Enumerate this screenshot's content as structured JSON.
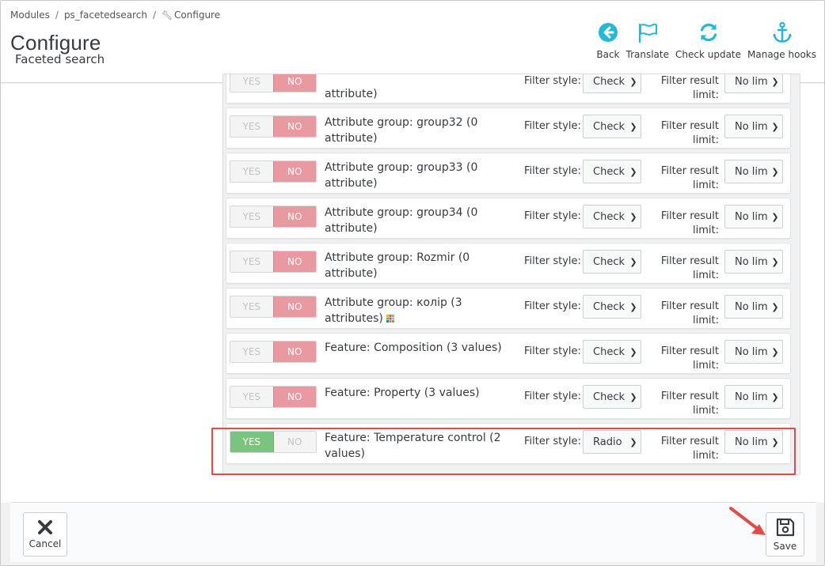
{
  "breadcrumb": {
    "items": [
      "Modules",
      "ps_facetedsearch",
      "Configure"
    ],
    "separator": "/"
  },
  "page": {
    "title": "Configure",
    "subtitle": "Faceted search"
  },
  "toolbar": {
    "back": "Back",
    "translate": "Translate",
    "check_update": "Check update",
    "manage_hooks": "Manage hooks"
  },
  "filter_rows": [
    {
      "label": "attribute)",
      "yes": "YES",
      "no": "NO",
      "enabled": false,
      "style_label": "Filter style:",
      "style_value": "Check",
      "limit_label": "Filter result limit:",
      "limit_value": "No limit"
    },
    {
      "label": "Attribute group: group32 (0 attribute)",
      "yes": "YES",
      "no": "NO",
      "enabled": false,
      "style_label": "Filter style:",
      "style_value": "Check",
      "limit_label": "Filter result limit:",
      "limit_value": "No limit"
    },
    {
      "label": "Attribute group: group33 (0 attribute)",
      "yes": "YES",
      "no": "NO",
      "enabled": false,
      "style_label": "Filter style:",
      "style_value": "Check",
      "limit_label": "Filter result limit:",
      "limit_value": "No limit"
    },
    {
      "label": "Attribute group: group34 (0 attribute)",
      "yes": "YES",
      "no": "NO",
      "enabled": false,
      "style_label": "Filter style:",
      "style_value": "Check",
      "limit_label": "Filter result limit:",
      "limit_value": "No limit"
    },
    {
      "label": "Attribute group: Rozmir (0 attribute)",
      "yes": "YES",
      "no": "NO",
      "enabled": false,
      "style_label": "Filter style:",
      "style_value": "Check",
      "limit_label": "Filter result limit:",
      "limit_value": "No limit"
    },
    {
      "label": "Attribute group: колір (3 attributes)",
      "yes": "YES",
      "no": "NO",
      "enabled": false,
      "style_label": "Filter style:",
      "style_value": "Check",
      "limit_label": "Filter result limit:",
      "limit_value": "No limit"
    },
    {
      "label": "Feature: Composition (3 values)",
      "yes": "YES",
      "no": "NO",
      "enabled": false,
      "style_label": "Filter style:",
      "style_value": "Check",
      "limit_label": "Filter result limit:",
      "limit_value": "No limit"
    },
    {
      "label": "Feature: Property (3 values)",
      "yes": "YES",
      "no": "NO",
      "enabled": false,
      "style_label": "Filter style:",
      "style_value": "Check",
      "limit_label": "Filter result limit:",
      "limit_value": "No limit"
    },
    {
      "label": "Feature: Temperature control (2 values)",
      "yes": "YES",
      "no": "NO",
      "enabled": true,
      "style_label": "Filter style:",
      "style_value": "Radio",
      "limit_label": "Filter result limit:",
      "limit_value": "No limit"
    }
  ],
  "footer": {
    "cancel": "Cancel",
    "save": "Save"
  },
  "colors": {
    "accent": "#25b9d7",
    "switch_no": "#e89aa0",
    "switch_yes": "#79c57e",
    "highlight": "#e34a4a"
  }
}
